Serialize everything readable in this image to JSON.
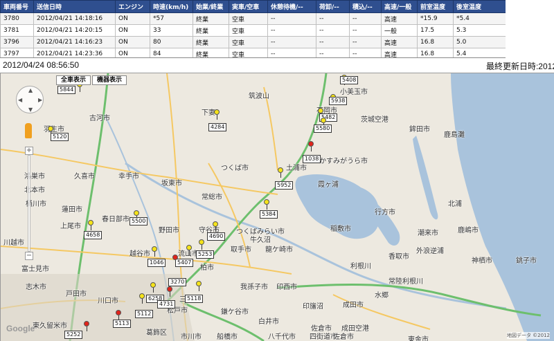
{
  "table": {
    "headers": [
      "車両番号",
      "送信日時",
      "エンジン",
      "時速(km/h)",
      "始業/終業",
      "実車/空車",
      "休憩待機/--",
      "荷卸/--",
      "積込/--",
      "高速/一般",
      "前室温度",
      "後室温度"
    ],
    "rows": [
      [
        "3780",
        "2012/04/21 14:18:16",
        "ON",
        "*57",
        "終業",
        "空車",
        "--",
        "--",
        "--",
        "高速",
        "*15.9",
        "*5.4"
      ],
      [
        "3781",
        "2012/04/21 14:20:15",
        "ON",
        "33",
        "終業",
        "空車",
        "--",
        "--",
        "--",
        "一般",
        "17.5",
        "5.3"
      ],
      [
        "3796",
        "2012/04/21 14:16:23",
        "ON",
        "80",
        "終業",
        "空車",
        "--",
        "--",
        "--",
        "高速",
        "16.8",
        "5.0"
      ],
      [
        "3797",
        "2012/04/21 14:23:36",
        "ON",
        "84",
        "終業",
        "空車",
        "--",
        "--",
        "--",
        "高速",
        "16.8",
        "5.4"
      ]
    ]
  },
  "info": {
    "timestamp": "2012/04/24 08:56:50",
    "last_updated": "最終更新日時:2012"
  },
  "map": {
    "buttons": {
      "all_vehicles": "全車表示",
      "device": "機器表示"
    },
    "zoom_in": "+",
    "zoom_out": "−",
    "logo": "Google",
    "copyright": "地図データ ©2012",
    "places": [
      "筑波山",
      "下妻",
      "小美玉市",
      "石岡市",
      "茨城空港",
      "鉾田市",
      "古河市",
      "羽生市",
      "鹿島灘",
      "つくば市",
      "かすみがうら市",
      "土浦市",
      "霞ヶ浦",
      "つくばみらい市",
      "幸手市",
      "坂東市",
      "久喜市",
      "鴻巣市",
      "北本市",
      "常総市",
      "桶川市",
      "蓮田市",
      "上尾市",
      "春日部市",
      "野田市",
      "守谷市",
      "牛久沼",
      "龍ケ崎市",
      "稲敷市",
      "潮来市",
      "行方市",
      "鹿嶋市",
      "利根川",
      "取手市",
      "川越市",
      "越谷市",
      "流山市",
      "柏市",
      "我孫子市",
      "印西市",
      "成田市",
      "香取市",
      "神栖市",
      "銚子市",
      "富士見市",
      "志木市",
      "戸田市",
      "川口市",
      "三郷市",
      "松戸市",
      "鎌ケ谷市",
      "印旛沼",
      "白井市",
      "佐倉市",
      "東久留米市",
      "葛飾区",
      "市川市",
      "船橋市",
      "八千代市",
      "四街道市",
      "佐倉市",
      "外浪逆浦",
      "北浦",
      "常陸利根川",
      "水郷",
      "成田空港",
      "東金市"
    ],
    "vehicles": [
      "5844",
      "5408",
      "5938",
      "5482",
      "5580",
      "4284",
      "5120",
      "1038",
      "5952",
      "5384",
      "5500",
      "4658",
      "4690",
      "5253",
      "5407",
      "1046",
      "3270",
      "5118",
      "6258",
      "4731",
      "5112",
      "5113",
      "5252"
    ]
  },
  "colors": {
    "header_bg": "#2f4f8f",
    "pin_yellow": "#f5e31a",
    "pin_red": "#e0241b",
    "water": "#a9c3dc",
    "highway": "#6dbf6d",
    "road": "#f5c862"
  }
}
